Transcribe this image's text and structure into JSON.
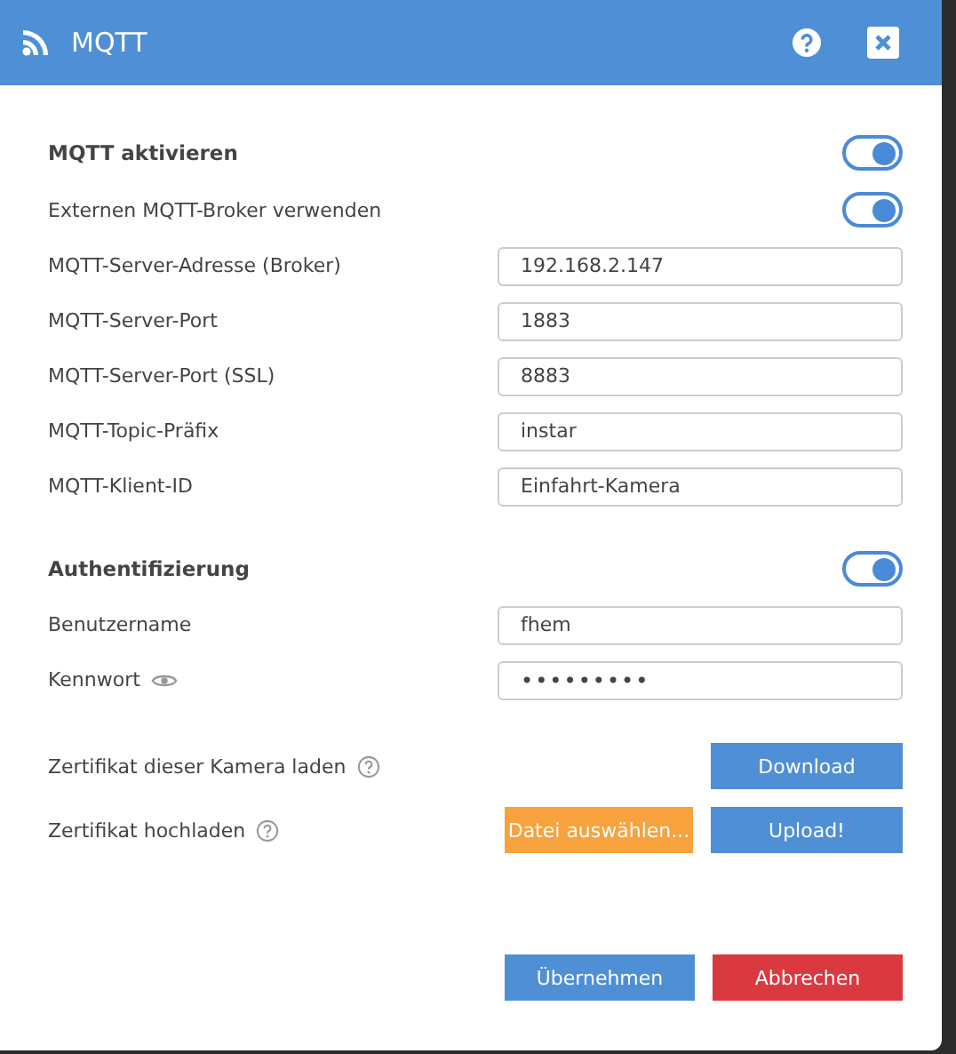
{
  "window": {
    "title": "MQTT"
  },
  "sections": [
    {
      "kind": "toggle",
      "label": "MQTT aktivieren",
      "bold": true,
      "on": true
    },
    {
      "kind": "toggle",
      "label": "Externen MQTT-Broker verwenden",
      "bold": false,
      "on": true
    },
    {
      "kind": "field",
      "label": "MQTT-Server-Adresse (Broker)",
      "value": "192.168.2.147"
    },
    {
      "kind": "field",
      "label": "MQTT-Server-Port",
      "value": "1883"
    },
    {
      "kind": "field",
      "label": "MQTT-Server-Port (SSL)",
      "value": "8883"
    },
    {
      "kind": "field",
      "label": "MQTT-Topic-Präfix",
      "value": "instar"
    },
    {
      "kind": "field",
      "label": "MQTT-Klient-ID",
      "value": "Einfahrt-Kamera"
    },
    {
      "kind": "gap"
    },
    {
      "kind": "toggle",
      "label": "Authentifizierung",
      "bold": true,
      "on": true
    },
    {
      "kind": "field",
      "label": "Benutzername",
      "value": "fhem"
    },
    {
      "kind": "password",
      "label": "Kennwort",
      "value": "•••••••••"
    },
    {
      "kind": "gap"
    },
    {
      "kind": "cert",
      "label": "Zertifikat dieser Kamera laden",
      "buttons": [
        {
          "label": "Download",
          "kind": "primary"
        }
      ]
    },
    {
      "kind": "cert",
      "label": "Zertifikat hochladen",
      "buttons": [
        {
          "label": "Datei auswählen...",
          "kind": "file"
        },
        {
          "label": "Upload!",
          "kind": "primary"
        }
      ]
    }
  ],
  "footer": [
    {
      "label": "Übernehmen",
      "kind": "primary"
    },
    {
      "label": "Abbrechen",
      "kind": "cancel"
    }
  ]
}
